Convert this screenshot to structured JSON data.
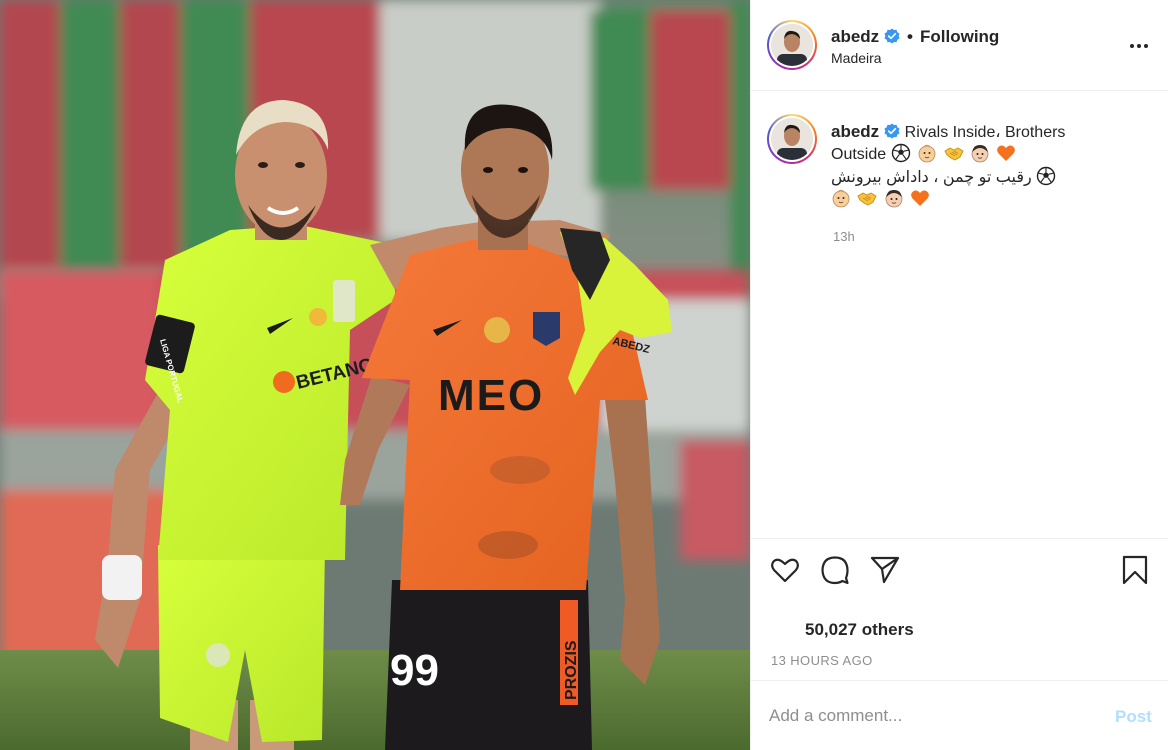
{
  "post": {
    "username": "abedz",
    "following_label": "Following",
    "separator": "•",
    "location": "Madeira",
    "caption": {
      "line1": "Rivals Inside، Brothers",
      "line2": "Outside",
      "line3": "رقیب تو چمن ، داداش بیرونش",
      "emojis_line2": [
        "soccer-ball",
        "baby-face",
        "handshake",
        "boy-face",
        "orange-heart"
      ],
      "emojis_line3": [
        "soccer-ball"
      ],
      "emojis_line4": [
        "baby-face",
        "handshake",
        "boy-face",
        "orange-heart"
      ]
    },
    "comment_time": "13h",
    "likes": "50,027 others",
    "time_ago": "13 HOURS AGO"
  },
  "photo": {
    "player_left_shirt": "BETANO",
    "player_right_shirt": "MEO",
    "player_right_number": "99",
    "glove_text": "ABEDZ",
    "shorts_sponsor": "PROZIS",
    "liga_badge": "LIGA PORTUGAL"
  },
  "comment_box": {
    "placeholder": "Add a comment...",
    "post_label": "Post"
  },
  "colors": {
    "verified": "#3897f0",
    "muted": "#8e8e8e",
    "post_disabled": "#b2dffc",
    "heart_orange": "#f4711e"
  },
  "icons": {
    "actions": [
      "heart-icon",
      "comment-icon",
      "share-icon",
      "bookmark-icon"
    ],
    "header": [
      "verified-badge-icon",
      "more-options-icon"
    ]
  }
}
